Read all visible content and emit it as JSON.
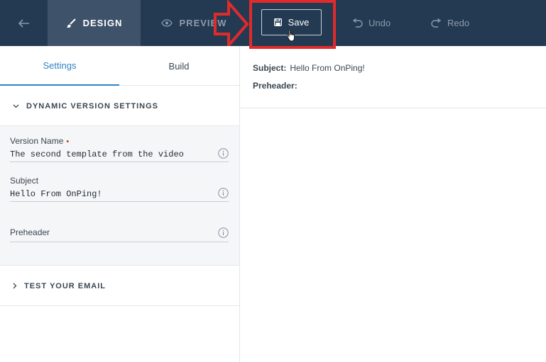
{
  "topbar": {
    "design_label": "DESIGN",
    "preview_label": "PREVIEW",
    "save_label": "Save",
    "undo_label": "Undo",
    "redo_label": "Redo"
  },
  "left_panel": {
    "tabs": [
      {
        "label": "Settings",
        "active": true
      },
      {
        "label": "Build",
        "active": false
      }
    ],
    "dynamic_section": {
      "title": "DYNAMIC VERSION SETTINGS",
      "expanded": true,
      "fields": [
        {
          "label": "Version Name",
          "required_mark": "•",
          "value": "The second template from the video"
        },
        {
          "label": "Subject",
          "value": "Hello From OnPing!"
        },
        {
          "label": "Preheader",
          "value": ""
        }
      ]
    },
    "test_section": {
      "title": "TEST YOUR EMAIL",
      "expanded": false
    }
  },
  "preview_meta": {
    "subject_label": "Subject:",
    "subject_value": "Hello From OnPing!",
    "preheader_label": "Preheader:",
    "preheader_value": ""
  },
  "colors": {
    "topbar_bg": "#243a52",
    "active_tab_bg": "#3e536a",
    "accent_blue": "#2e84c6",
    "highlight_red": "#e02b2b"
  },
  "icons": {
    "back": "arrow-left-icon",
    "design": "brush-icon",
    "preview": "eye-icon",
    "save": "floppy-disk-icon",
    "undo": "undo-icon",
    "redo": "redo-icon",
    "info": "info-circle-icon",
    "expanded": "chevron-down-icon",
    "collapsed": "chevron-right-icon"
  }
}
